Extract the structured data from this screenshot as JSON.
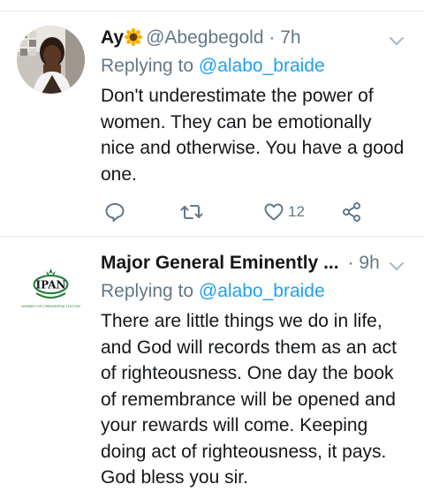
{
  "tweets": [
    {
      "display_name": "Ay",
      "name_emoji": "sunflower-emoji",
      "handle": "@Abegbegold",
      "separator": "·",
      "time": "7h",
      "replying_prefix": "Replying to",
      "replying_to": "@alabo_braide",
      "text": "Don't underestimate the power of women. They can be emotionally nice and otherwise. You have a good one.",
      "actions": {
        "reply_icon": "comment-icon",
        "retweet_icon": "retweet-icon",
        "like_icon": "heart-icon",
        "like_count": "12",
        "share_icon": "share-icon"
      }
    },
    {
      "display_name": "Major General Eminently ...",
      "handle": "",
      "separator": "·",
      "time": "9h",
      "replying_prefix": "Replying to",
      "replying_to": "@alabo_braide",
      "text": "There are little things we do in life, and God will records them as an act of righteousness. One day the book of remembrance will be opened and your rewards will come. Keeping doing act of righteousness, it pays. God bless you sir.",
      "avatar_logo_text": "IPAN",
      "avatar_logo_subtext": "NOMINEE FOR 2 PRESIDENTIAL ELECTION"
    }
  ],
  "colors": {
    "text_primary": "#14171a",
    "text_secondary": "#657786",
    "link": "#1da1f2",
    "divider": "#e1e8ed",
    "logo_green": "#1e7b34"
  }
}
